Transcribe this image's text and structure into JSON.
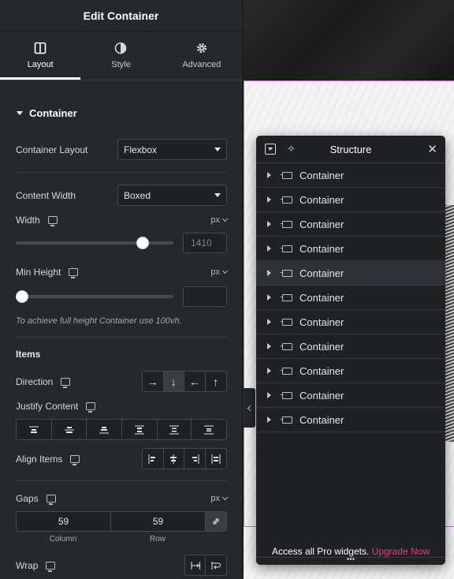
{
  "header": {
    "title": "Edit Container"
  },
  "tabs": [
    {
      "label": "Layout",
      "icon": "layout-icon",
      "active": true
    },
    {
      "label": "Style",
      "icon": "style-icon",
      "active": false
    },
    {
      "label": "Advanced",
      "icon": "gear-icon",
      "active": false
    }
  ],
  "section": {
    "title": "Container"
  },
  "container_layout": {
    "label": "Container Layout",
    "value": "Flexbox"
  },
  "content_width": {
    "label": "Content Width",
    "value": "Boxed"
  },
  "width": {
    "label": "Width",
    "unit": "px",
    "value": "1410",
    "slider_fraction": 0.83
  },
  "min_height": {
    "label": "Min Height",
    "unit": "px",
    "value": "",
    "slider_fraction": 0.0,
    "hint": "To achieve full height Container use 100vh."
  },
  "items": {
    "title": "Items"
  },
  "direction": {
    "label": "Direction",
    "options": [
      "→",
      "↓",
      "←",
      "↑"
    ],
    "selected": 1
  },
  "justify_content": {
    "label": "Justify Content"
  },
  "align_items": {
    "label": "Align Items"
  },
  "gaps": {
    "label": "Gaps",
    "unit": "px",
    "column": "59",
    "row": "59",
    "column_label": "Column",
    "row_label": "Row"
  },
  "wrap": {
    "label": "Wrap"
  },
  "structure": {
    "title": "Structure",
    "items": [
      "Container",
      "Container",
      "Container",
      "Container",
      "Container",
      "Container",
      "Container",
      "Container",
      "Container",
      "Container",
      "Container"
    ],
    "highlighted_index": 4,
    "footer_text": "Access all Pro widgets.",
    "footer_link": "Upgrade Now",
    "dots": "•••"
  },
  "colors": {
    "accent_link": "#e23f8a",
    "canvas_outline": "#d36be0"
  }
}
